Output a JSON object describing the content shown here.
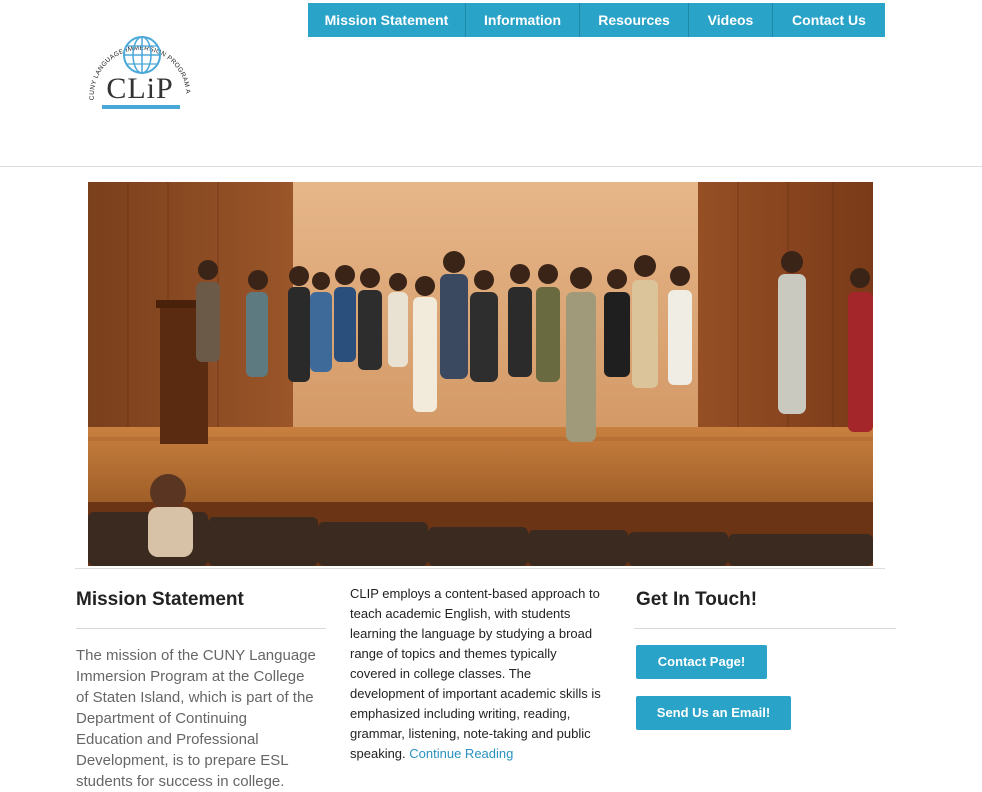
{
  "logo": {
    "arc_text": "CUNY LANGUAGE IMMERSION PROGRAM AT THE",
    "arc_text_bold": "COLLEGE OF STATEN ISLAND",
    "wordmark": "CLiP"
  },
  "nav": {
    "items": [
      {
        "label": "Mission Statement"
      },
      {
        "label": "Information"
      },
      {
        "label": "Resources"
      },
      {
        "label": "Videos"
      },
      {
        "label": "Contact Us"
      }
    ]
  },
  "mission": {
    "heading": "Mission Statement",
    "text": "The mission of the CUNY Language Immersion Program at the College of Staten Island, which is part of the Department of Continuing Education and Professional Development, is to prepare ESL students for success in college."
  },
  "approach": {
    "text": "CLIP employs a content-based approach to teach academic English, with students learning the language by studying a broad range of topics and themes typically covered in college classes. The development of important academic skills is emphasized including writing, reading, grammar, listening, note-taking and public speaking.",
    "link": "Continue Reading"
  },
  "contact": {
    "heading": "Get In Touch!",
    "button1": "Contact Page!",
    "button2": "Send Us an Email!"
  },
  "colors": {
    "accent": "#2aa3c8",
    "link": "#2a92c0"
  }
}
